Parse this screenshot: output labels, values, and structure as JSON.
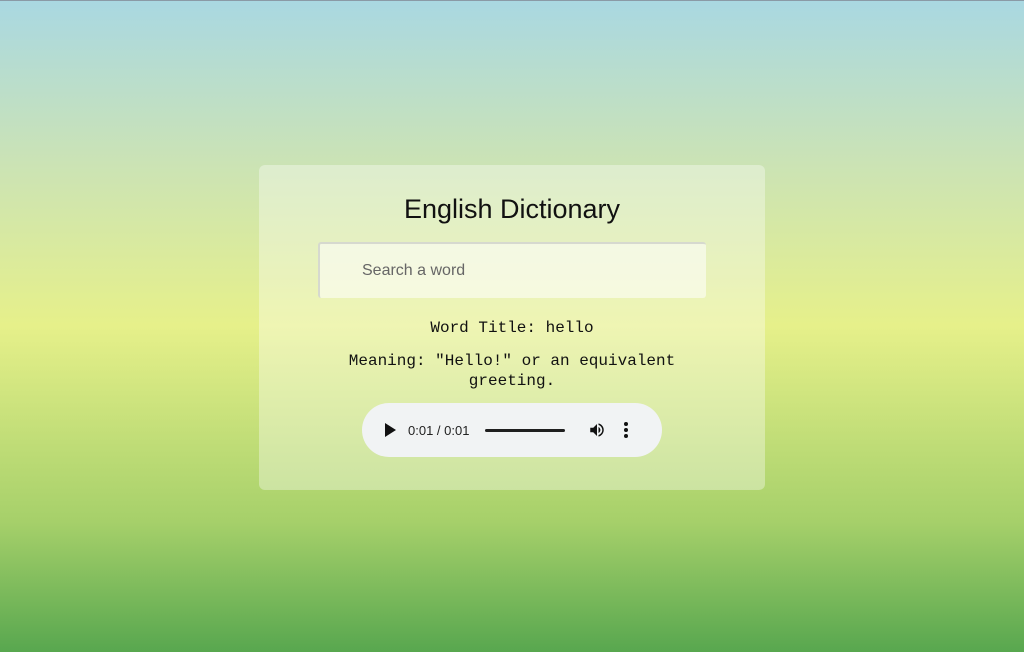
{
  "app": {
    "title": "English Dictionary"
  },
  "search": {
    "placeholder": "Search a word",
    "value": ""
  },
  "result": {
    "word_title": "Word Title: hello",
    "meaning": "Meaning: \"Hello!\" or an equivalent greeting."
  },
  "audio_player": {
    "time": "0:01 / 0:01",
    "progress_fraction": 1.0,
    "icons": {
      "play": "play-icon",
      "volume": "volume-icon",
      "more": "more-vert-icon"
    }
  }
}
